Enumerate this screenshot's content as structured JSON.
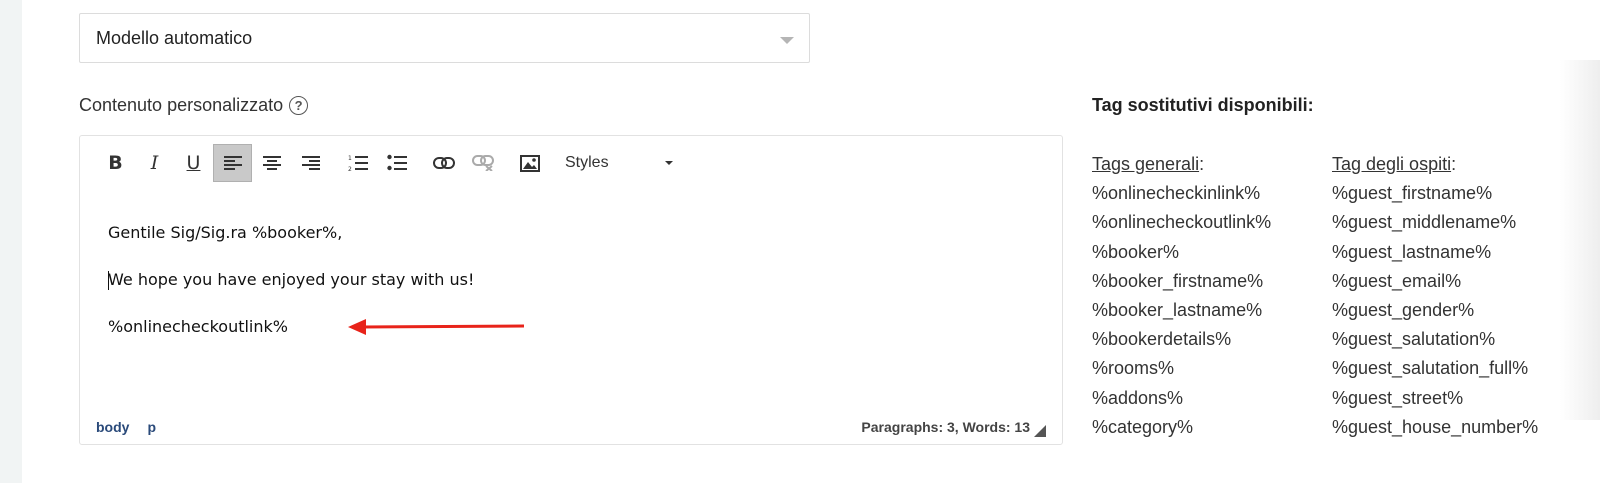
{
  "template_select": {
    "value": "Modello automatico"
  },
  "custom_content": {
    "label": "Contenuto personalizzato",
    "help_symbol": "?"
  },
  "toolbar": {
    "bold": "B",
    "italic": "I",
    "underline": "U",
    "styles_label": "Styles"
  },
  "editor": {
    "paragraphs": [
      "Gentile Sig/Sig.ra %booker%,",
      "We hope you have enjoyed your stay with us!",
      "%onlinecheckoutlink%"
    ],
    "status_path": [
      "body",
      "p"
    ],
    "word_count": "Paragraphs: 3, Words: 13"
  },
  "annotation": {
    "arrow_color": "#e8231a"
  },
  "tags": {
    "title": "Tag sostitutivi disponibili:",
    "general": {
      "heading": "Tags generali",
      "items": [
        "%onlinecheckinlink%",
        "%onlinecheckoutlink%",
        "%booker%",
        "%booker_firstname%",
        "%booker_lastname%",
        "%bookerdetails%",
        "%rooms%",
        "%addons%",
        "%category%"
      ]
    },
    "guests": {
      "heading": "Tag degli ospiti",
      "items": [
        "%guest_firstname%",
        "%guest_middlename%",
        "%guest_lastname%",
        "%guest_email%",
        "%guest_gender%",
        "%guest_salutation%",
        "%guest_salutation_full%",
        "%guest_street%",
        "%guest_house_number%"
      ]
    }
  }
}
